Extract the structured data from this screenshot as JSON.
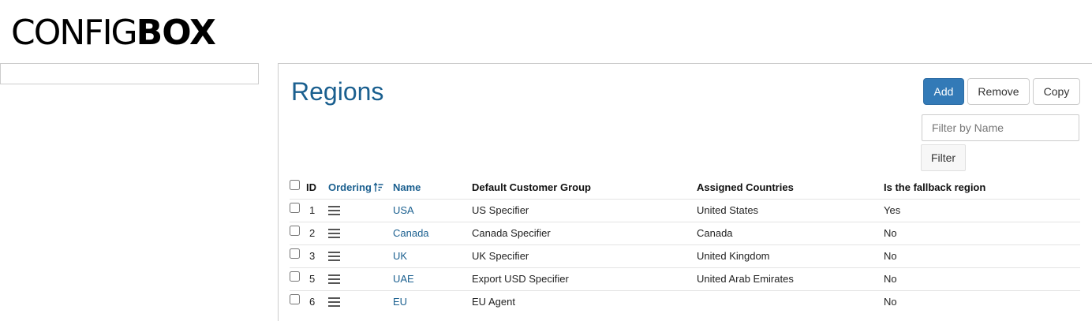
{
  "logo": {
    "light": "CONFIG",
    "bold": "BOX"
  },
  "page": {
    "title": "Regions"
  },
  "toolbar": {
    "add_label": "Add",
    "remove_label": "Remove",
    "copy_label": "Copy"
  },
  "filter": {
    "placeholder": "Filter by Name",
    "value": "",
    "button_label": "Filter"
  },
  "table": {
    "headers": {
      "id": "ID",
      "ordering": "Ordering",
      "name": "Name",
      "default_group": "Default Customer Group",
      "countries": "Assigned Countries",
      "fallback": "Is the fallback region"
    },
    "rows": [
      {
        "id": "1",
        "name": "USA",
        "group": "US Specifier",
        "countries": "United States",
        "fallback": "Yes"
      },
      {
        "id": "2",
        "name": "Canada",
        "group": "Canada Specifier",
        "countries": "Canada",
        "fallback": "No"
      },
      {
        "id": "3",
        "name": "UK",
        "group": "UK Specifier",
        "countries": "United Kingdom",
        "fallback": "No"
      },
      {
        "id": "5",
        "name": "UAE",
        "group": "Export USD Specifier",
        "countries": "United Arab Emirates",
        "fallback": "No"
      },
      {
        "id": "6",
        "name": "EU",
        "group": "EU Agent",
        "countries": "",
        "fallback": "No"
      }
    ]
  },
  "icons": {
    "sort": "sort-ascending-icon",
    "drag": "drag-handle-icon"
  },
  "colors": {
    "accent": "#1a5f8f",
    "primary_button": "#337ab7"
  }
}
